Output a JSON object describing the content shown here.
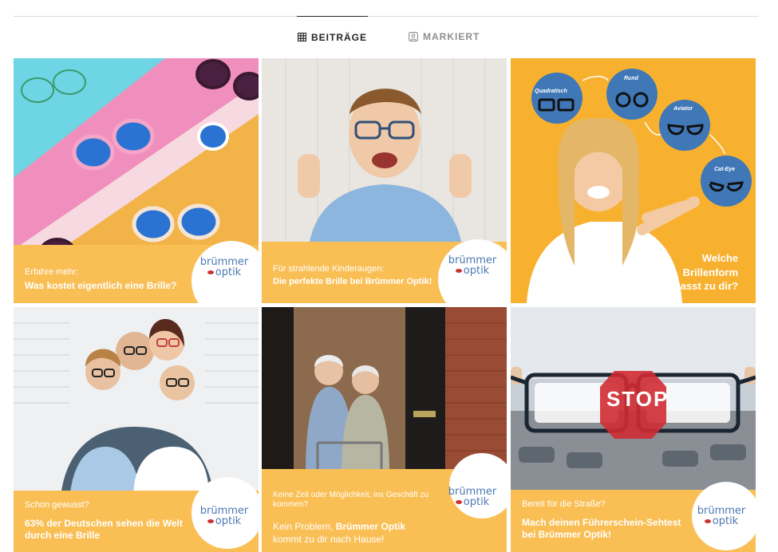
{
  "tabs": [
    {
      "label": "BEITRÄGE",
      "icon": "grid-icon",
      "active": true
    },
    {
      "label": "MARKIERT",
      "icon": "tagged-icon",
      "active": false
    }
  ],
  "posts": [
    {
      "sub": "Erfahre mehr:",
      "main": "Was kostet eigentlich eine Brille?",
      "logo_line1": "brümmer",
      "logo_line2": "optik"
    },
    {
      "sub": "Für strahlende Kinderaugen:",
      "main": "Die perfekte Brille bei Brümmer Optik!",
      "logo_line1": "brümmer",
      "logo_line2": "optik"
    },
    {
      "labels": [
        "Quadratisch",
        "Rund",
        "Aviator",
        "Cat-Eye"
      ],
      "main_lines": [
        "Welche",
        "Brillenform",
        "passt zu dir?"
      ]
    },
    {
      "sub": "Schon gewusst?",
      "main": "63% der Deutschen sehen die Welt durch eine Brille",
      "logo_line1": "brümmer",
      "logo_line2": "optik"
    },
    {
      "sub": "Keine Zeit oder Möglichkeit, ins Geschäft zu kommen?",
      "main_a": "Kein Problem, ",
      "main_b": "Brümmer Optik",
      "main_c": "kommt zu dir nach Hause!",
      "logo_line1": "brümmer",
      "logo_line2": "optik"
    },
    {
      "sub": "Bereit für die Straße?",
      "main": "Mach deinen Führerschein-Sehtest bei Brümmer Optik!",
      "logo_line1": "brümmer",
      "logo_line2": "optik",
      "sign": "STOP"
    }
  ],
  "colors": {
    "banner": "#f9bf55",
    "logo_blue": "#4a78b3",
    "shape_circle": "#3f77b7"
  }
}
